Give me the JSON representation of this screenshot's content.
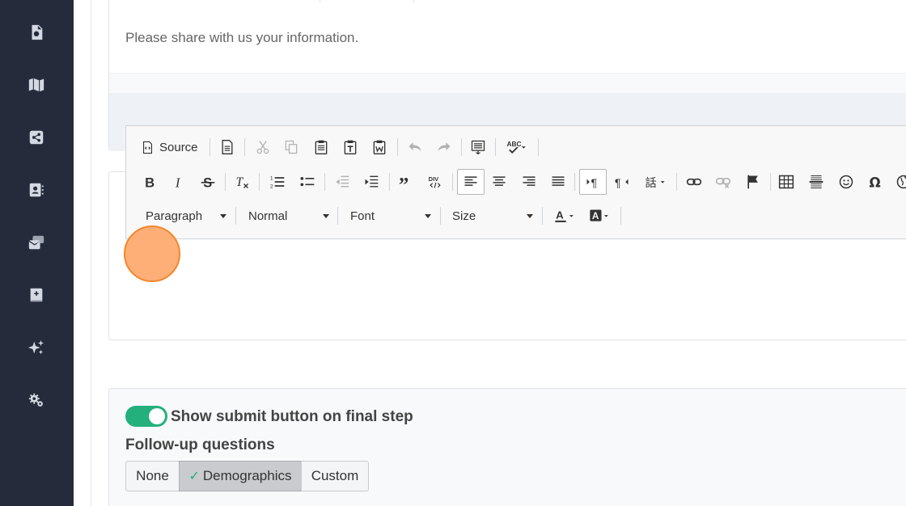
{
  "form": {
    "intro_text": "Please share with us your information."
  },
  "editor": {
    "source_label": "Source",
    "combos": {
      "format": "Paragraph",
      "style": "Normal",
      "font": "Font",
      "size": "Size"
    }
  },
  "settings": {
    "submit_toggle_label": "Show submit button on final step",
    "submit_toggle_on": true,
    "followup_label": "Follow-up questions",
    "followup_options": [
      "None",
      "Demographics",
      "Custom"
    ],
    "followup_selected": "Demographics"
  },
  "colors": {
    "sidebar": "#252b3b",
    "accent": "#23b07d",
    "marker": "#fdab70"
  }
}
